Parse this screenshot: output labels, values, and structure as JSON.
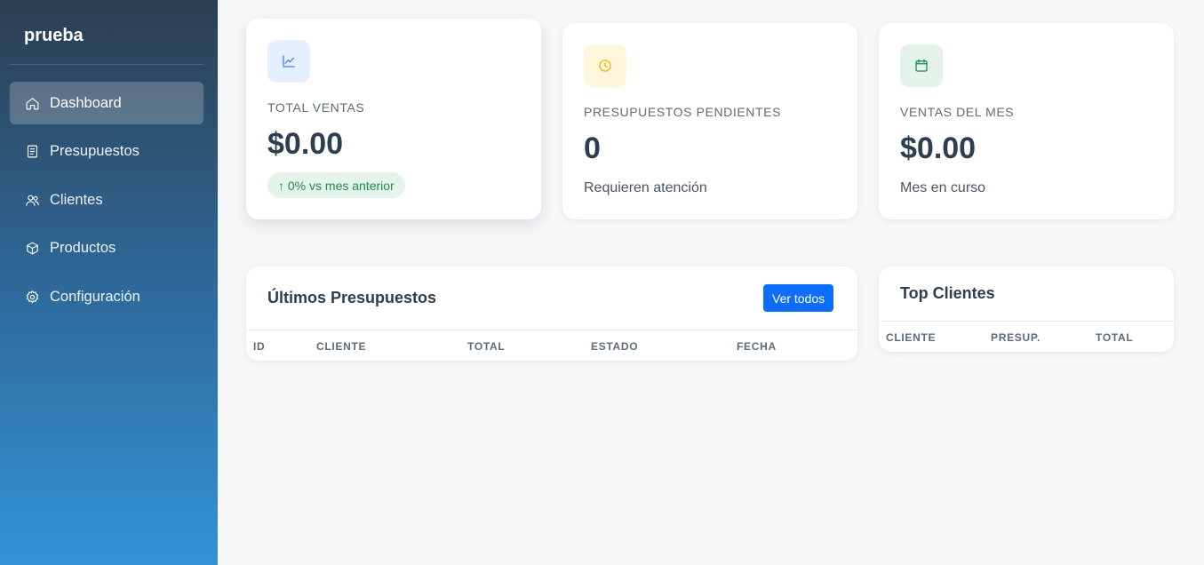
{
  "sidebar": {
    "brand": "prueba",
    "items": [
      {
        "label": "Dashboard",
        "icon": "home-icon",
        "active": true
      },
      {
        "label": "Presupuestos",
        "icon": "document-icon"
      },
      {
        "label": "Clientes",
        "icon": "users-icon"
      },
      {
        "label": "Productos",
        "icon": "box-icon"
      },
      {
        "label": "Configuración",
        "icon": "gear-icon"
      }
    ]
  },
  "stats": [
    {
      "label": "TOTAL VENTAS",
      "value": "$0.00",
      "badge": "↑ 0% vs mes anterior",
      "icon": "chart-line-icon",
      "icon_color": "#3b82f6",
      "icon_bg": "#e6efff"
    },
    {
      "label": "PRESUPUESTOS PENDIENTES",
      "value": "0",
      "sub": "Requieren atención",
      "icon": "clock-icon",
      "icon_color": "#f5b301",
      "icon_bg": "#fff6dc"
    },
    {
      "label": "VENTAS DEL MES",
      "value": "$0.00",
      "sub": "Mes en curso",
      "icon": "calendar-icon",
      "icon_color": "#198754",
      "icon_bg": "#e3f3e9"
    }
  ],
  "latest_quotes": {
    "title": "Últimos Presupuestos",
    "button": "Ver todos",
    "columns": [
      "ID",
      "CLIENTE",
      "TOTAL",
      "ESTADO",
      "FECHA"
    ],
    "rows": []
  },
  "top_clients": {
    "title": "Top Clientes",
    "columns": [
      "CLIENTE",
      "PRESUP.",
      "TOTAL"
    ],
    "rows": []
  },
  "colors": {
    "accent": "#0d6efd",
    "positive": "#1f8a4c",
    "sidebar_top": "#2c3e50",
    "sidebar_bottom": "#3393d6"
  }
}
